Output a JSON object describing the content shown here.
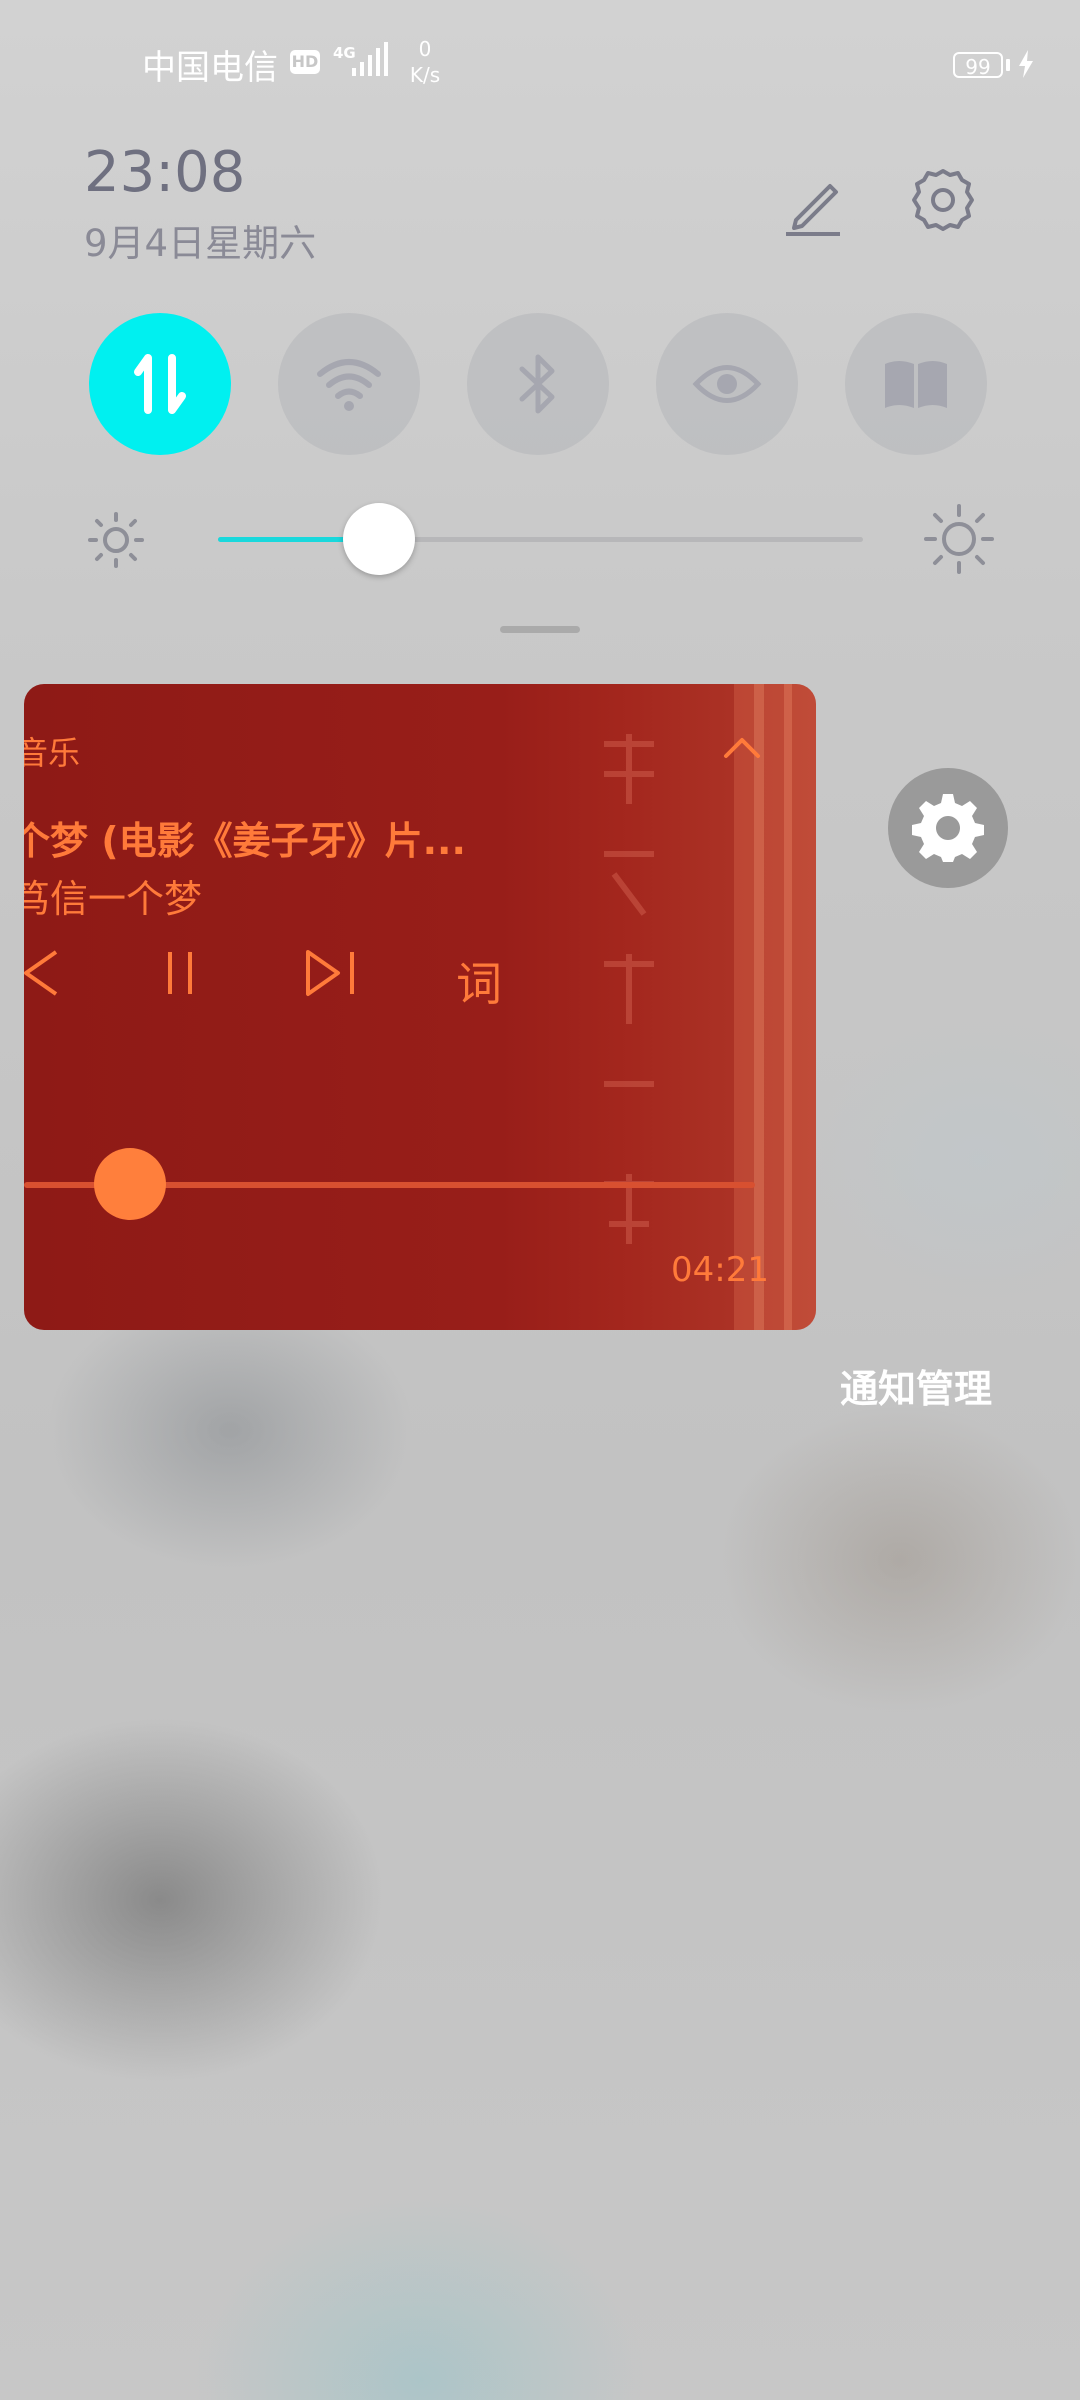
{
  "status_bar": {
    "carrier": "中国电信",
    "hd_badge": "HD",
    "network_type": "4G",
    "speed_value": "0",
    "speed_unit": "K/s",
    "battery_level": "99",
    "icons": [
      "signal-icon",
      "battery-icon",
      "charging-bolt-icon"
    ]
  },
  "header": {
    "time": "23:08",
    "date": "9月4日星期六",
    "icons": [
      "edit-icon",
      "settings-icon"
    ]
  },
  "quick_toggles": [
    {
      "name": "mobile-data",
      "icon": "data-transfer-icon",
      "active": true
    },
    {
      "name": "wifi",
      "icon": "wifi-icon",
      "active": false
    },
    {
      "name": "bluetooth",
      "icon": "bluetooth-icon",
      "active": false
    },
    {
      "name": "eye-comfort",
      "icon": "eye-icon",
      "active": false
    },
    {
      "name": "reading-mode",
      "icon": "book-icon",
      "active": false
    }
  ],
  "brightness": {
    "level": 0.25,
    "icons": [
      "brightness-low-icon",
      "brightness-high-icon"
    ]
  },
  "music_card": {
    "app_name": "音乐",
    "title": "个梦 (电影《姜子牙》片...",
    "artist": "笃信一个梦",
    "lyrics_label": "词",
    "duration": "04:21",
    "progress": 0.15,
    "colors": {
      "accent": "#ff7a3a",
      "background": "#8e1a16"
    },
    "icons": [
      "collapse-chevron-icon",
      "previous-icon",
      "pause-icon",
      "next-icon"
    ]
  },
  "notification_settings_icon": "gear-icon",
  "notification_manage_label": "通知管理",
  "colors": {
    "active_toggle": "#00f0f0",
    "slider_fill": "#19d8dc"
  }
}
